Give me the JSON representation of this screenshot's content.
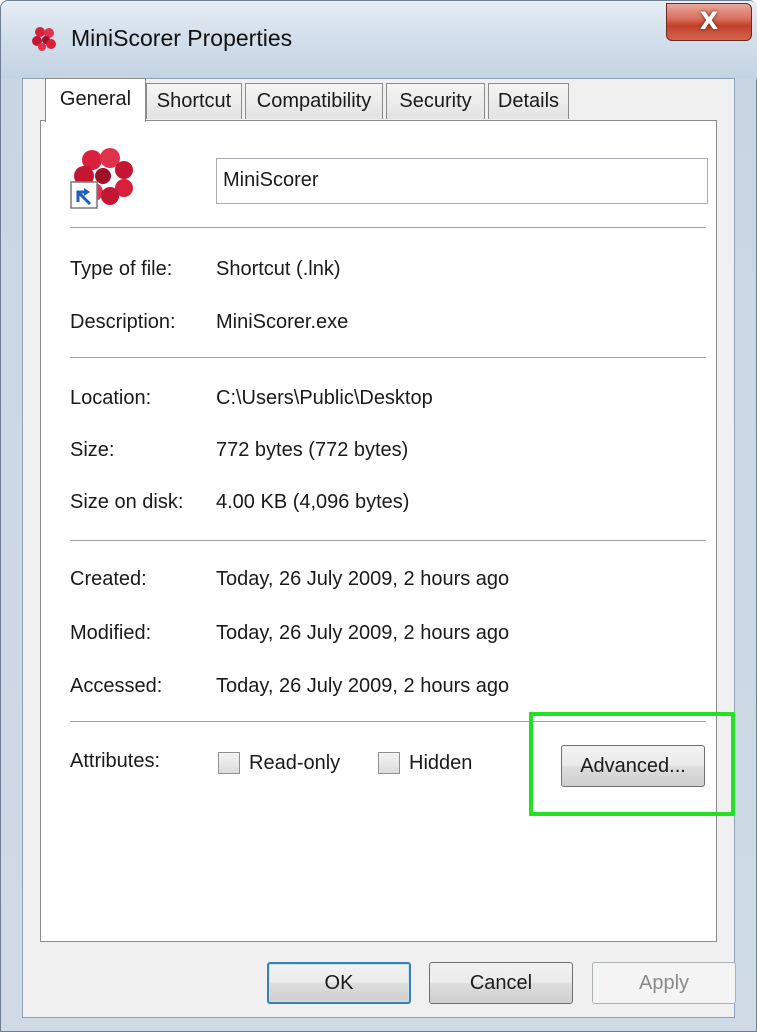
{
  "window": {
    "title": "MiniScorer Properties",
    "close_glyph": "X",
    "title_icon": "red-molecule-icon"
  },
  "tabs": [
    {
      "label": "General",
      "active": true
    },
    {
      "label": "Shortcut",
      "active": false
    },
    {
      "label": "Compatibility",
      "active": false
    },
    {
      "label": "Security",
      "active": false
    },
    {
      "label": "Details",
      "active": false
    }
  ],
  "general": {
    "file_icon": "red-molecule-shortcut-icon",
    "name_value": "MiniScorer",
    "type_label": "Type of file:",
    "type_value": "Shortcut (.lnk)",
    "description_label": "Description:",
    "description_value": "MiniScorer.exe",
    "location_label": "Location:",
    "location_value": "C:\\Users\\Public\\Desktop",
    "size_label": "Size:",
    "size_value": "772 bytes (772 bytes)",
    "size_on_disk_label": "Size on disk:",
    "size_on_disk_value": "4.00 KB (4,096 bytes)",
    "created_label": "Created:",
    "created_value": "Today, 26 July 2009, 2 hours ago",
    "modified_label": "Modified:",
    "modified_value": "Today, 26 July 2009, 2 hours ago",
    "accessed_label": "Accessed:",
    "accessed_value": "Today, 26 July 2009, 2 hours ago",
    "attributes_label": "Attributes:",
    "readonly_label": "Read-only",
    "hidden_label": "Hidden",
    "advanced_label": "Advanced..."
  },
  "buttons": {
    "ok": "OK",
    "cancel": "Cancel",
    "apply": "Apply"
  },
  "colors": {
    "highlight": "#22e022",
    "close": "#c2402a",
    "icon_red": "#d81f3c"
  }
}
